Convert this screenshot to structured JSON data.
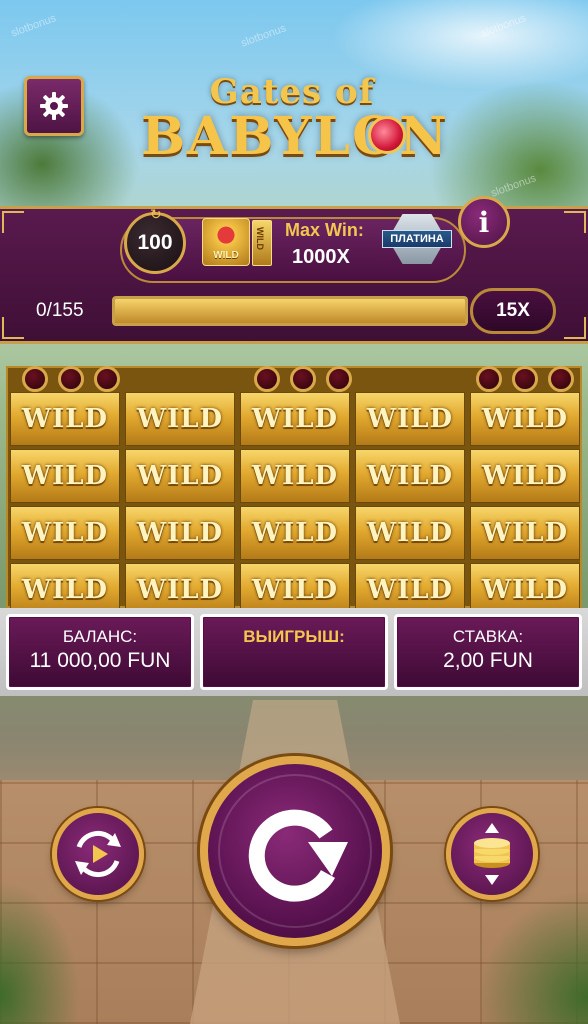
{
  "logo": {
    "line1": "Gates of",
    "line2": "BABYLON"
  },
  "feature": {
    "spins": "100",
    "wild_label": "WILD",
    "wild_strip_label": "WILD",
    "max_win_label": "Max Win:",
    "max_win_value": "1000X",
    "badge": "ПЛАТИНА"
  },
  "progress": {
    "label": "0/155",
    "fraction": 1.0,
    "multiplier": "15X"
  },
  "grid": {
    "symbol": "WILD",
    "rows": 4,
    "columns": 5
  },
  "stats": {
    "balance_label": "БАЛАНС:",
    "balance_value": "11 000,00 FUN",
    "win_label": "ВЫИГРЫШ:",
    "win_value": "",
    "bet_label": "СТАВКА:",
    "bet_value": "2,00 FUN"
  },
  "watermark": "slotbonus",
  "icons": {
    "settings": "gear-icon",
    "info": "info-icon",
    "spin": "spin-arrow-icon",
    "autoplay": "autoplay-icon",
    "bet": "coin-stack-icon"
  },
  "colors": {
    "purple": "#5a1a4e",
    "gold": "#d8a84a",
    "wild_gold": "#e2a92f"
  }
}
